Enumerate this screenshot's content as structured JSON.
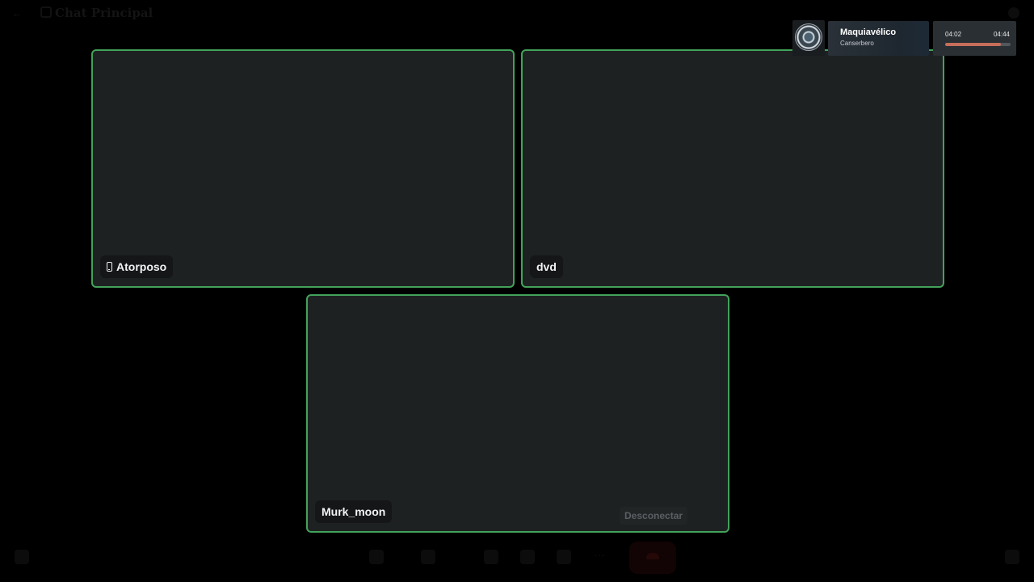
{
  "header": {
    "channel_title": "Chat Principal"
  },
  "participants": [
    {
      "name": "Atorposo",
      "device": "mobile"
    },
    {
      "name": "dvd",
      "device": ""
    },
    {
      "name": "Murk_moon",
      "device": ""
    }
  ],
  "controls": {
    "disconnect_label": "Desconectar"
  },
  "now_playing": {
    "title": "Maquiavélico",
    "artist": "Canserbero",
    "current_time": "04:02",
    "total_time": "04:44",
    "progress_fraction": 0.85
  },
  "colors": {
    "speaking_border": "#43a25a",
    "tile_background": "#1e2122",
    "progress_fill": "#c66e5a"
  }
}
